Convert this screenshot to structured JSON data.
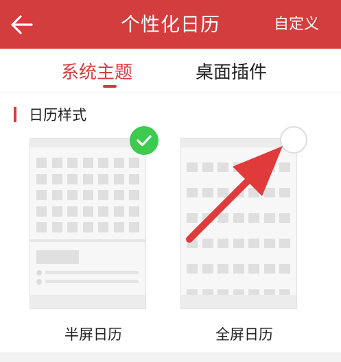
{
  "header": {
    "title": "个性化日历",
    "right_action": "自定义",
    "back_icon": "arrow-left-icon",
    "background": "#d43d3d"
  },
  "tabs": [
    {
      "label": "系统主题",
      "active": true
    },
    {
      "label": "桌面插件",
      "active": false
    }
  ],
  "section": {
    "title": "日历样式"
  },
  "styles": [
    {
      "label": "半屏日历",
      "selected": true,
      "badge_icon": "check-circle-icon",
      "badge_color": "#3ec94f"
    },
    {
      "label": "全屏日历",
      "selected": false,
      "badge_icon": "radio-empty-icon"
    }
  ],
  "annotation": {
    "icon": "red-arrow-icon",
    "color": "#e03a3a"
  }
}
